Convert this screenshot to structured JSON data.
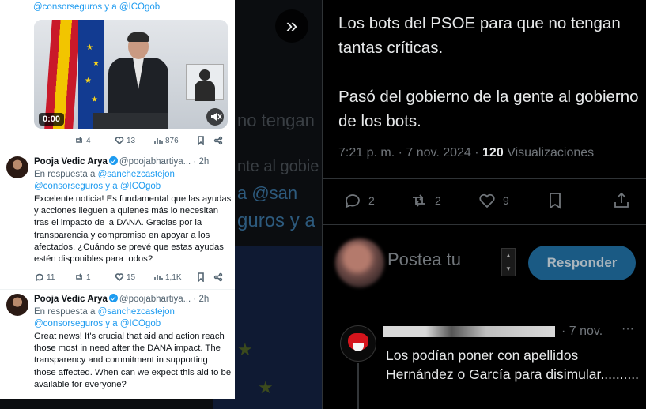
{
  "left_card": {
    "top_mentions": "@consorseguros y a @ICOgob",
    "video": {
      "time": "0:00"
    },
    "first_stats": {
      "replies": "4",
      "retweets": "",
      "likes": "13",
      "views": "876"
    },
    "tweets": [
      {
        "name": "Pooja Vedic Arya",
        "handle": "@poojabhartiya...",
        "time": "2h",
        "reply_prefix": "En respuesta a",
        "reply_to_1": "@sanchezcastejon",
        "reply_to_2": "@consorseguros y a @ICOgob",
        "text": "Excelente noticia! Es fundamental que las ayudas y acciones lleguen a quienes más lo necesitan tras el impacto de la DANA. Gracias por la transparencia y compromiso en apoyar a los afectados. ¿Cuándo se prevé que estas ayudas estén disponibles para todos?",
        "stats": {
          "replies": "11",
          "retweets": "1",
          "likes": "15",
          "views": "1,1K"
        }
      },
      {
        "name": "Pooja Vedic Arya",
        "handle": "@poojabhartiya...",
        "time": "2h",
        "reply_prefix": "En respuesta a",
        "reply_to_1": "@sanchezcastejon",
        "reply_to_2": "@consorseguros y a @ICOgob",
        "text": "Great news! It's crucial that aid and action reach those most in need after the DANA impact. The transparency and commitment in supporting those affected. When can we expect this aid to be available for everyone?"
      }
    ]
  },
  "background_ghost_text": {
    "line1": "no tengan",
    "line2": "nte al gobie",
    "line3": "a @san",
    "line4": "guros y a"
  },
  "main_tweet": {
    "paragraph_1": "Los bots del PSOE para que no tengan tantas críticas.",
    "paragraph_2": "Pasó del gobierno de la gente al gobierno de los bots.",
    "timestamp": "7:21 p. m. · 7 nov. 2024 ·",
    "views_count": "120",
    "views_label": "Visualizaciones"
  },
  "actions": {
    "replies": "2",
    "retweets": "2",
    "likes": "9"
  },
  "compose": {
    "placeholder": "Postea tu",
    "button": "Responder"
  },
  "reply": {
    "date": "· 7 nov.",
    "text": "Los podían poner con apellidos Hernández o García para disimular.........."
  },
  "colors": {
    "accent": "#1d9bf0",
    "dark_bg": "#000000",
    "button_bg": "#1a5a84"
  }
}
